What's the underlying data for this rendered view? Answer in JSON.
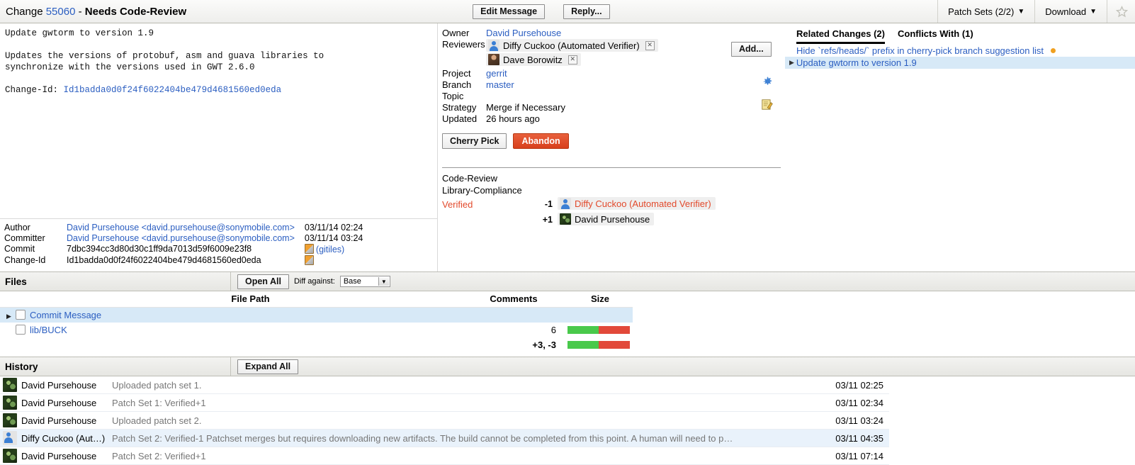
{
  "header": {
    "change_word": "Change",
    "change_number": "55060",
    "separator": " - ",
    "status": "Needs Code-Review",
    "edit_message_label": "Edit Message",
    "reply_label": "Reply...",
    "patch_sets_label": "Patch Sets (2/2)",
    "download_label": "Download",
    "caret": "▼",
    "star_icon": "star-outline-icon"
  },
  "commit_message": {
    "subject": "Update gwtorm to version 1.9",
    "body": "Updates the versions of protobuf, asm and guava libraries to\nsynchronize with the versions used in GWT 2.6.0",
    "change_id_label": "Change-Id:",
    "change_id_value": "Id1badda0d0f24f6022404be479d4681560ed0eda"
  },
  "author_block": {
    "rows": [
      {
        "label": "Author",
        "value": "David Pursehouse <david.pursehouse@sonymobile.com>",
        "date": "03/11/14 02:24",
        "link": true
      },
      {
        "label": "Committer",
        "value": "David Pursehouse <david.pursehouse@sonymobile.com>",
        "date": "03/11/14 03:24",
        "link": true
      },
      {
        "label": "Commit",
        "value": "7dbc394cc3d80d30c1ff9da7013d59f6009e23f8",
        "date": "(gitiles)",
        "link": false
      },
      {
        "label": "Change-Id",
        "value": "Id1badda0d0f24f6022404be479d4681560ed0eda",
        "date": "",
        "link": false
      }
    ]
  },
  "metadata": {
    "owner_label": "Owner",
    "owner_value": "David Pursehouse",
    "reviewers_label": "Reviewers",
    "reviewers": [
      {
        "name": "Diffy Cuckoo (Automated Verifier)",
        "avatar": "generic-person-icon",
        "remove_icon": "remove-x-icon"
      },
      {
        "name": "Dave Borowitz",
        "avatar": "photo-avatar",
        "remove_icon": "remove-x-icon"
      }
    ],
    "add_label": "Add...",
    "project_label": "Project",
    "project_value": "gerrit",
    "branch_label": "Branch",
    "branch_value": "master",
    "topic_label": "Topic",
    "topic_value": "",
    "strategy_label": "Strategy",
    "strategy_value": "Merge if Necessary",
    "updated_label": "Updated",
    "updated_value": "26 hours ago",
    "cherry_pick_label": "Cherry Pick",
    "abandon_label": "Abandon",
    "gear_icon": "gear-icon",
    "edit_topic_icon": "edit-note-icon"
  },
  "labels": {
    "rows": [
      {
        "name": "Code-Review",
        "negative": false,
        "votes": []
      },
      {
        "name": "Library-Compliance",
        "negative": false,
        "votes": []
      },
      {
        "name": "Verified",
        "negative": true,
        "votes": [
          {
            "score": "-1",
            "voter": "Diffy Cuckoo (Automated Verifier)",
            "avatar": "generic-person-icon",
            "negative": true
          },
          {
            "score": "+1",
            "voter": "David Pursehouse",
            "avatar": "photo-avatar",
            "negative": false
          }
        ]
      }
    ]
  },
  "related": {
    "tabs": [
      {
        "label": "Related Changes (2)",
        "active": true
      },
      {
        "label": "Conflicts With (1)",
        "active": false
      }
    ],
    "items": [
      {
        "text": "Hide `refs/heads/` prefix in cherry-pick branch suggestion list",
        "current": false,
        "dot": true
      },
      {
        "text": "Update gwtorm to version 1.9",
        "current": true,
        "dot": false
      }
    ]
  },
  "files": {
    "section_title": "Files",
    "open_all_label": "Open All",
    "diff_against_label": "Diff against:",
    "diff_against_value": "Base",
    "columns": {
      "file_path": "File Path",
      "comments": "Comments",
      "size": "Size"
    },
    "rows": [
      {
        "path": "Commit Message",
        "comments": "",
        "selected": true,
        "has_triangle": true,
        "green_pct": 50,
        "show_bar": false
      },
      {
        "path": "lib/BUCK",
        "comments": "6",
        "selected": false,
        "has_triangle": false,
        "green_pct": 50,
        "show_bar": true
      }
    ],
    "total": {
      "delta": "+3, -3",
      "green_pct": 50
    }
  },
  "history": {
    "section_title": "History",
    "expand_all_label": "Expand All",
    "rows": [
      {
        "author": "David Pursehouse",
        "avatar": "photo-avatar",
        "message": "Uploaded patch set 1.",
        "date": "03/11 02:25",
        "highlight": false
      },
      {
        "author": "David Pursehouse",
        "avatar": "photo-avatar",
        "message": "Patch Set 1: Verified+1",
        "date": "03/11 02:34",
        "highlight": false
      },
      {
        "author": "David Pursehouse",
        "avatar": "photo-avatar",
        "message": "Uploaded patch set 2.",
        "date": "03/11 03:24",
        "highlight": false
      },
      {
        "author": "Diffy Cuckoo (Aut…)",
        "avatar": "generic-person-icon",
        "message": "Patch Set 2: Verified-1 Patchset merges but requires downloading new artifacts. The build cannot be completed from this point. A human will need to p…",
        "date": "03/11 04:35",
        "highlight": true
      },
      {
        "author": "David Pursehouse",
        "avatar": "photo-avatar",
        "message": "Patch Set 2: Verified+1",
        "date": "03/11 07:14",
        "highlight": false
      }
    ]
  },
  "colors": {
    "link": "#2b5ec1",
    "negative": "#e2492b",
    "added": "#49c94b",
    "removed": "#e2493a",
    "selected_row": "#d7e9f7",
    "abandon": "#d8401c"
  }
}
